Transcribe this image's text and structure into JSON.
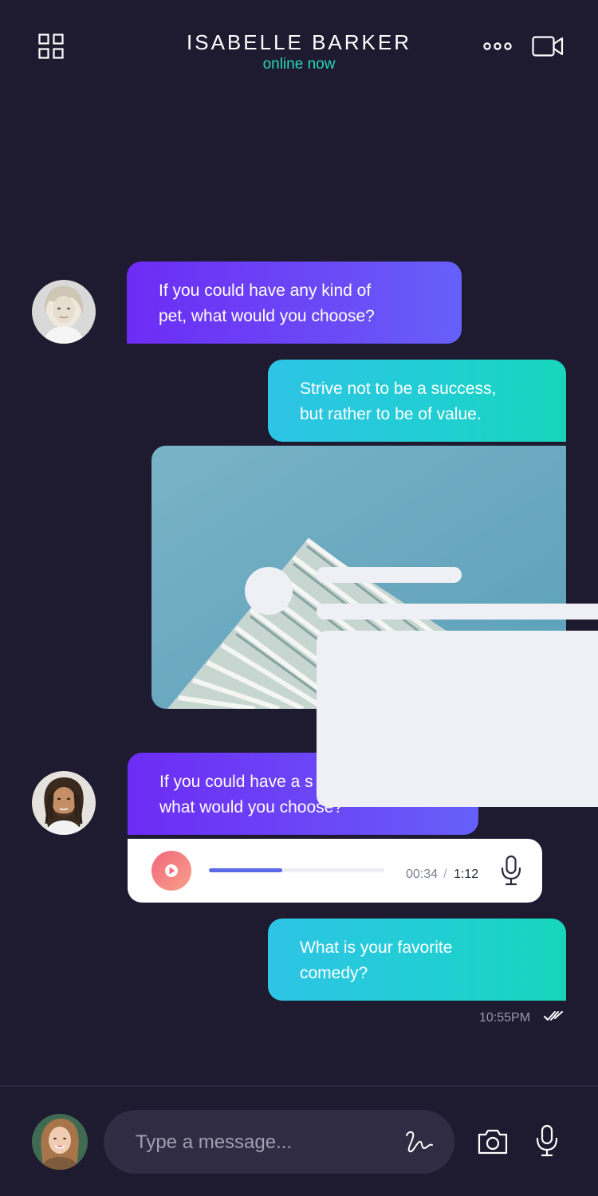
{
  "header": {
    "contact_name": "ISABELLE BARKER",
    "status": "online now",
    "menu_icon": "grid-icon",
    "more_icon": "more-icon",
    "video_icon": "video-camera-icon"
  },
  "messages": [
    {
      "type": "incoming",
      "lines": [
        "If you could have any kind of",
        "pet, what would you choose?"
      ]
    },
    {
      "type": "outgoing",
      "lines": [
        "Strive not to be a success,",
        "but rather to be of value."
      ]
    },
    {
      "type": "image",
      "description": "building-photo"
    },
    {
      "type": "incoming",
      "lines": [
        "If you could have a s",
        "what would you choose?"
      ]
    },
    {
      "type": "voice",
      "current_time": "00:34",
      "separator": "/",
      "total_time": "1:12",
      "progress": 0.42
    },
    {
      "type": "outgoing",
      "lines": [
        "What is your favorite",
        "comedy?"
      ]
    }
  ],
  "timestamp": "10:55PM",
  "composer": {
    "placeholder": "Type a message...",
    "icons": [
      "scribble-icon",
      "camera-icon",
      "microphone-icon"
    ]
  },
  "colors": {
    "background": "#1e1a30",
    "accent_green": "#26d7b8",
    "incoming_gradient": [
      "#6d2cf5",
      "#6660fb"
    ],
    "outgoing_gradient": [
      "#2ec4e6",
      "#17d6bb"
    ],
    "play_button": "#f2687d",
    "progress": "#5b6be6"
  }
}
